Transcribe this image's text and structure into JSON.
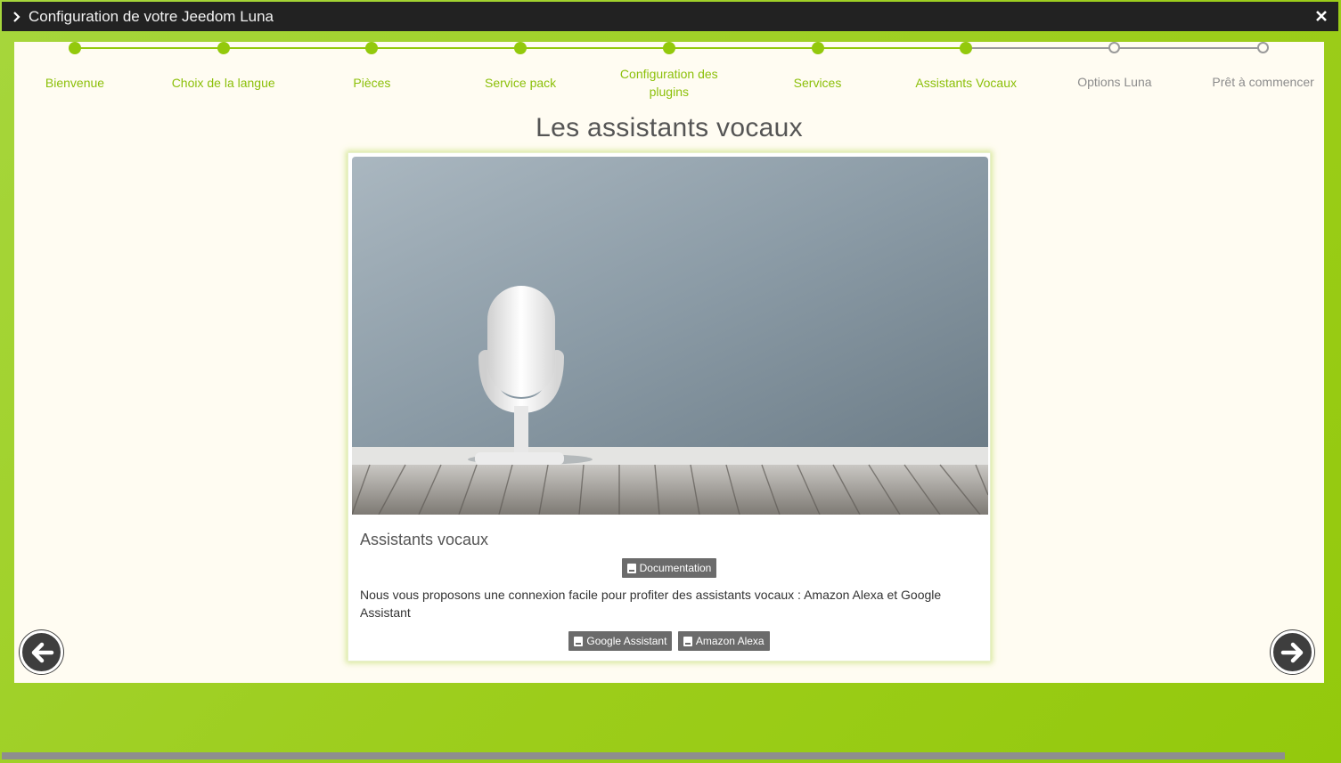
{
  "window": {
    "title": "Configuration de votre Jeedom Luna",
    "accent_color": "#93c90c",
    "titlebar_color": "#222222"
  },
  "stepper": {
    "steps": [
      {
        "label": "Bienvenue",
        "status": "done"
      },
      {
        "label": "Choix de la langue",
        "status": "done"
      },
      {
        "label": "Pièces",
        "status": "done"
      },
      {
        "label": "Service pack",
        "status": "done"
      },
      {
        "label": "Configuration des plugins",
        "status": "done"
      },
      {
        "label": "Services",
        "status": "done"
      },
      {
        "label": "Assistants Vocaux",
        "status": "current"
      },
      {
        "label": "Options Luna",
        "status": "todo"
      },
      {
        "label": "Prêt à commencer",
        "status": "todo"
      }
    ]
  },
  "main": {
    "heading": "Les assistants vocaux",
    "card": {
      "image_icon": "microphone-icon",
      "title": "Assistants vocaux",
      "documentation_label": "Documentation",
      "description": "Nous vous proposons une connexion facile pour profiter des assistants vocaux : Amazon Alexa et Google Assistant",
      "links": [
        {
          "label": "Google Assistant",
          "icon": "book-icon"
        },
        {
          "label": "Amazon Alexa",
          "icon": "book-icon"
        }
      ]
    }
  },
  "navigation": {
    "prev_icon": "arrow-left-icon",
    "next_icon": "arrow-right-icon"
  }
}
